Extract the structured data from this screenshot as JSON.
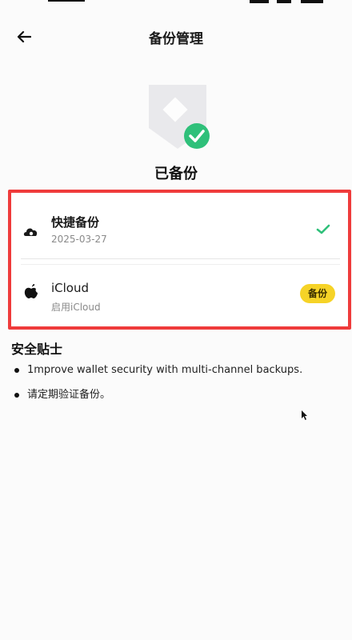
{
  "header": {
    "title": "备份管理",
    "back_icon": "arrow-left-icon"
  },
  "hero": {
    "icon": "shield-check-icon",
    "status": "已备份",
    "accent": "#2fc07a"
  },
  "backup_methods": [
    {
      "icon": "cloud-icon",
      "label": "快捷备份",
      "sub": "2025-03-27",
      "action_icon": "check-icon"
    },
    {
      "icon": "apple-icon",
      "label": "iCloud",
      "sub": "启用iCloud",
      "action_label": "备份"
    }
  ],
  "tips": {
    "title": "安全贴士",
    "items": [
      "1mprove wallet security with multi-channel backups.",
      "请定期验证备份。"
    ]
  },
  "colors": {
    "highlight": "#ef3b3b",
    "badge": "#f6d327",
    "check": "#2fc07a"
  }
}
